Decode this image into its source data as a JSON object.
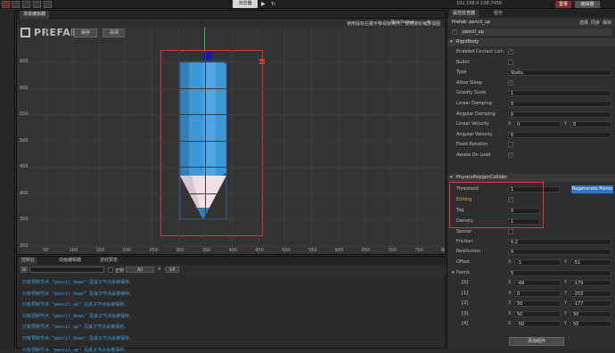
{
  "topbar": {
    "browser_label": "浏览器",
    "ip_text": "192.168.0.108:7456",
    "login_label": "登录",
    "edit_label": "编辑器"
  },
  "scene": {
    "tab_label": "场景编辑器",
    "rendering_label": "Rendering",
    "hint": "使用鼠标右键平移视窗焦点，使用滚轮缩放视图",
    "logo_text": "PREFAB",
    "save_label": "保存",
    "close_label": "关闭",
    "y_labels": [
      "650",
      "600",
      "550",
      "500",
      "450",
      "400",
      "350",
      "300"
    ],
    "x_labels": [
      "50",
      "100",
      "150",
      "200",
      "250",
      "300",
      "350",
      "400",
      "450",
      "500",
      "550",
      "600",
      "650",
      "700",
      "750",
      "800"
    ]
  },
  "console": {
    "tabs": [
      "控制台",
      "动画编辑器",
      "游戏预览"
    ],
    "filter_all": "All",
    "regex_label": "正则",
    "font_size": "14",
    "lines": [
      "只有预制节点 \"pencil_down\" 及其子节点会被保存。",
      "只有预制节点 \"pencil_down\" 及其子节点会被保存。",
      "只有预制节点 \"pencil_up\" 及其子节点会被保存。",
      "只有预制节点 \"pencil_down\" 及其子节点会被保存。",
      "只有预制节点 \"pencil_up\" 及其子节点会被保存。",
      "只有预制节点 \"pencil_down\" 及其子节点会被保存。",
      "只有预制节点 \"pencil_up\" 及其子节点会被保存。"
    ]
  },
  "inspector": {
    "tabs": [
      "属性检查器",
      "服务"
    ],
    "prefab_label": "Prefab: pencil_up",
    "prefab_actions": [
      "选择",
      "同步",
      "保存"
    ],
    "node_name": "pencil_up",
    "rigidbody": {
      "title": "RigidBody",
      "rows": [
        {
          "label": "Enabled Contact List..",
          "type": "check",
          "value": "✓"
        },
        {
          "label": "Bullet",
          "type": "check",
          "value": ""
        },
        {
          "label": "Type",
          "type": "select",
          "value": "Static"
        },
        {
          "label": "Allow Sleep",
          "type": "check",
          "value": "✓"
        },
        {
          "label": "Gravity Scale",
          "type": "text",
          "value": "1"
        },
        {
          "label": "Linear Damping",
          "type": "text",
          "value": "0"
        },
        {
          "label": "Angular Damping",
          "type": "text",
          "value": "0"
        },
        {
          "label": "Linear Velocity",
          "type": "xy",
          "x": "0",
          "y": "0"
        },
        {
          "label": "Angular Velocity",
          "type": "text",
          "value": "0"
        },
        {
          "label": "Fixed Rotation",
          "type": "check",
          "value": ""
        },
        {
          "label": "Awake On Load",
          "type": "check",
          "value": "✓"
        }
      ]
    },
    "collider": {
      "title": "PhysicsPolygonCollider",
      "threshold_label": "Threshold",
      "threshold_value": "1",
      "regen_label": "Regenerate Points",
      "editing_label": "Editing",
      "editing_value": "✓",
      "tag_label": "Tag",
      "tag_value": "0",
      "density_label": "Density",
      "density_value": "1",
      "sensor_label": "Sensor",
      "friction_label": "Friction",
      "friction_value": "0.2",
      "restitution_label": "Restitution",
      "restitution_value": "0",
      "offset_label": "Offset",
      "offset_x": "-1",
      "offset_y": "-51",
      "points_label": "Points",
      "points_count": "5",
      "points": [
        {
          "idx": "[0]",
          "x": "-49",
          "y": "-179"
        },
        {
          "idx": "[1]",
          "x": "0",
          "y": "-253"
        },
        {
          "idx": "[2]",
          "x": "50",
          "y": "-177"
        },
        {
          "idx": "[3]",
          "x": "50",
          "y": "50"
        },
        {
          "idx": "[4]",
          "x": "-50",
          "y": "50"
        }
      ]
    },
    "add_component_label": "添加组件"
  }
}
